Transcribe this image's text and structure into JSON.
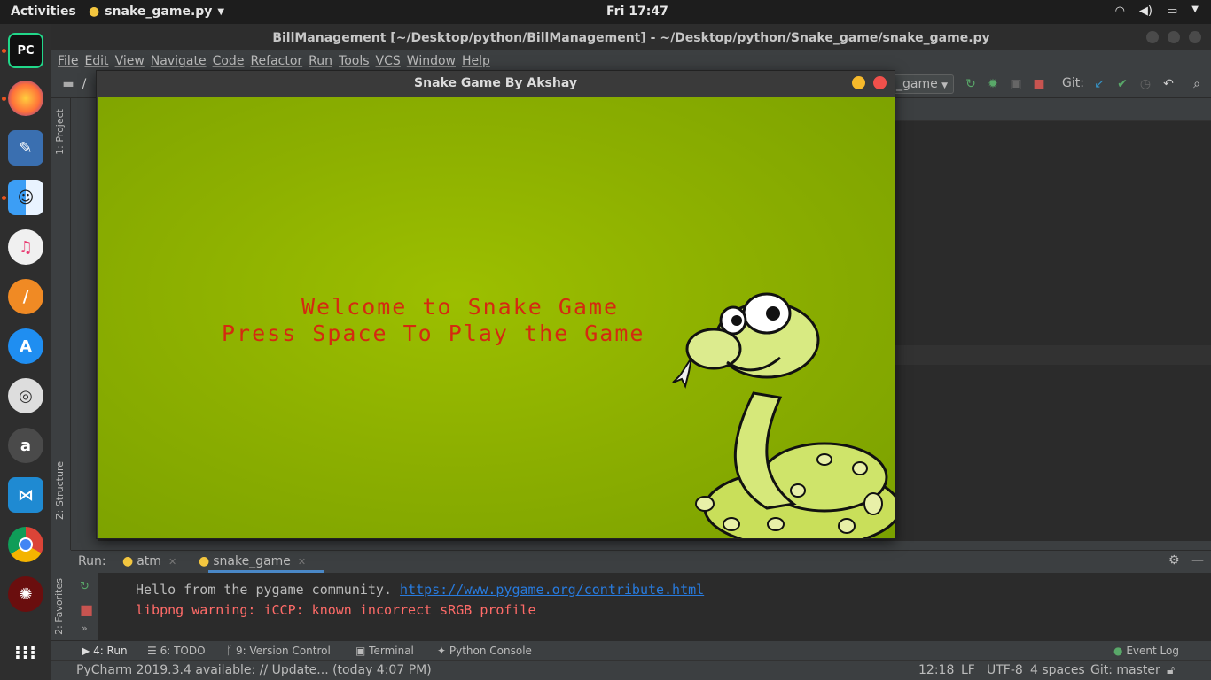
{
  "topbar": {
    "activities": "Activities",
    "app_name": "snake_game.py",
    "clock": "Fri 17:47"
  },
  "ide": {
    "title": "BillManagement [~/Desktop/python/BillManagement] - ~/Desktop/python/Snake_game/snake_game.py",
    "menu": [
      "File",
      "Edit",
      "View",
      "Navigate",
      "Code",
      "Refactor",
      "Run",
      "Tools",
      "VCS",
      "Window",
      "Help"
    ],
    "run_config": "_game",
    "git_label": "Git:",
    "side_tabs": {
      "project": "1: Project",
      "structure": "Z: Structure",
      "favorites": "2: Favorites"
    }
  },
  "run_panel": {
    "label": "Run:",
    "tabs": [
      "atm",
      "snake_game"
    ],
    "console_line1_text": "Hello from the pygame community. ",
    "console_line1_link": "https://www.pygame.org/contribute.html",
    "console_line2": "libpng warning: iCCP: known incorrect sRGB profile"
  },
  "bottom_tabs": [
    "4: Run",
    "6: TODO",
    "9: Version Control",
    "Terminal",
    "Python Console"
  ],
  "event_log": "Event Log",
  "status": {
    "message": "PyCharm 2019.3.4 available: // Update... (today 4:07 PM)",
    "position": "12:18",
    "line_sep": "LF",
    "encoding": "UTF-8",
    "indent": "4 spaces",
    "git_branch": "Git: master"
  },
  "game": {
    "title": "Snake Game By Akshay",
    "line1": "Welcome to Snake Game",
    "line2": "Press Space To Play the Game"
  },
  "colors": {
    "game_text": "#d42a10",
    "game_bg": "#8db000",
    "link": "#287bde",
    "warning": "#ff6b68"
  }
}
